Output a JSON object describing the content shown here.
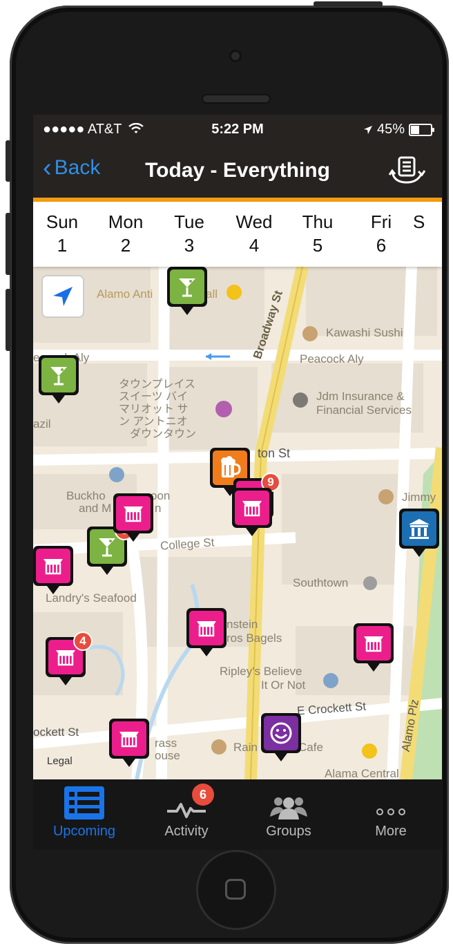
{
  "status_bar": {
    "carrier": "●●●●● AT&T",
    "time": "5:22 PM",
    "battery": "45%",
    "battery_level": 0.45
  },
  "nav": {
    "back_label": "Back",
    "title": "Today - Everything",
    "sync_icon": "sync-list-icon"
  },
  "days": [
    {
      "name": "Sun",
      "num": "1"
    },
    {
      "name": "Mon",
      "num": "2"
    },
    {
      "name": "Tue",
      "num": "3"
    },
    {
      "name": "Wed",
      "num": "4"
    },
    {
      "name": "Thu",
      "num": "5"
    },
    {
      "name": "Fri",
      "num": "6"
    },
    {
      "name": "S",
      "num": ""
    }
  ],
  "map": {
    "labels": {
      "alamo": "Alamo Anti",
      "all": "all",
      "kawashi": "Kawashi Sushi",
      "peacock_left": "eacock Aly",
      "peacock_right": "Peacock Aly",
      "broadway": "Broadway St",
      "jp1": "タウンプレイス",
      "jp2": "スイーツ バイ",
      "jp3": "マリオット サ",
      "jp4": "ン アントニオ",
      "jp5": "ダウンタウン",
      "jdm1": "Jdm Insurance &",
      "jdm2": "Financial Services",
      "azil": "azil",
      "ton": "ton St",
      "buckho1": "Buckho",
      "buckho2": "oon",
      "buckho3": "and M",
      "buckho4": "n",
      "jimmy": "Jimmy",
      "college": "College St",
      "southtown": "Southtown",
      "landrys": "Landry's Seafood",
      "einstein1": "nstein",
      "einstein2": "ros Bagels",
      "ripley1": "Ripley's Believe",
      "ripley2": "It Or Not",
      "ecrockett": "E Crockett St",
      "crockett": "ockett St",
      "alamoplz": "Alamo Plz",
      "rain": "Rain",
      "cafe": "Cafe",
      "rass": "rass",
      "ouse": "ouse",
      "alamacentral": "Alama Central",
      "legal": "Legal"
    },
    "pins": [
      {
        "type": "cocktail",
        "color": "#7cb342",
        "badge": ""
      },
      {
        "type": "cocktail",
        "color": "#7cb342",
        "badge": ""
      },
      {
        "type": "beer",
        "color": "#f07c1b",
        "badge": ""
      },
      {
        "type": "shopping",
        "color": "#ec1e8c",
        "badge": "9"
      },
      {
        "type": "shopping",
        "color": "#ec1e8c",
        "badge": ""
      },
      {
        "type": "cocktail",
        "color": "#7cb342",
        "badge": "3"
      },
      {
        "type": "shopping",
        "color": "#ec1e8c",
        "badge": ""
      },
      {
        "type": "museum",
        "color": "#1c6fb2",
        "badge": ""
      },
      {
        "type": "shopping",
        "color": "#ec1e8c",
        "badge": ""
      },
      {
        "type": "shopping",
        "color": "#ec1e8c",
        "badge": ""
      },
      {
        "type": "shopping",
        "color": "#ec1e8c",
        "badge": "4"
      },
      {
        "type": "shopping",
        "color": "#ec1e8c",
        "badge": ""
      },
      {
        "type": "smiley",
        "color": "#7b2fa0",
        "badge": ""
      },
      {
        "type": "shopping",
        "color": "#ec1e8c",
        "badge": ""
      }
    ]
  },
  "tabs": [
    {
      "label": "Upcoming",
      "icon": "list-icon",
      "active": true
    },
    {
      "label": "Activity",
      "icon": "pulse-icon",
      "badge": "6"
    },
    {
      "label": "Groups",
      "icon": "people-icon"
    },
    {
      "label": "More",
      "icon": "more-dots-icon"
    }
  ],
  "colors": {
    "accent": "#f39c12",
    "active_tab": "#1a74e8",
    "back": "#2f8fe6"
  }
}
